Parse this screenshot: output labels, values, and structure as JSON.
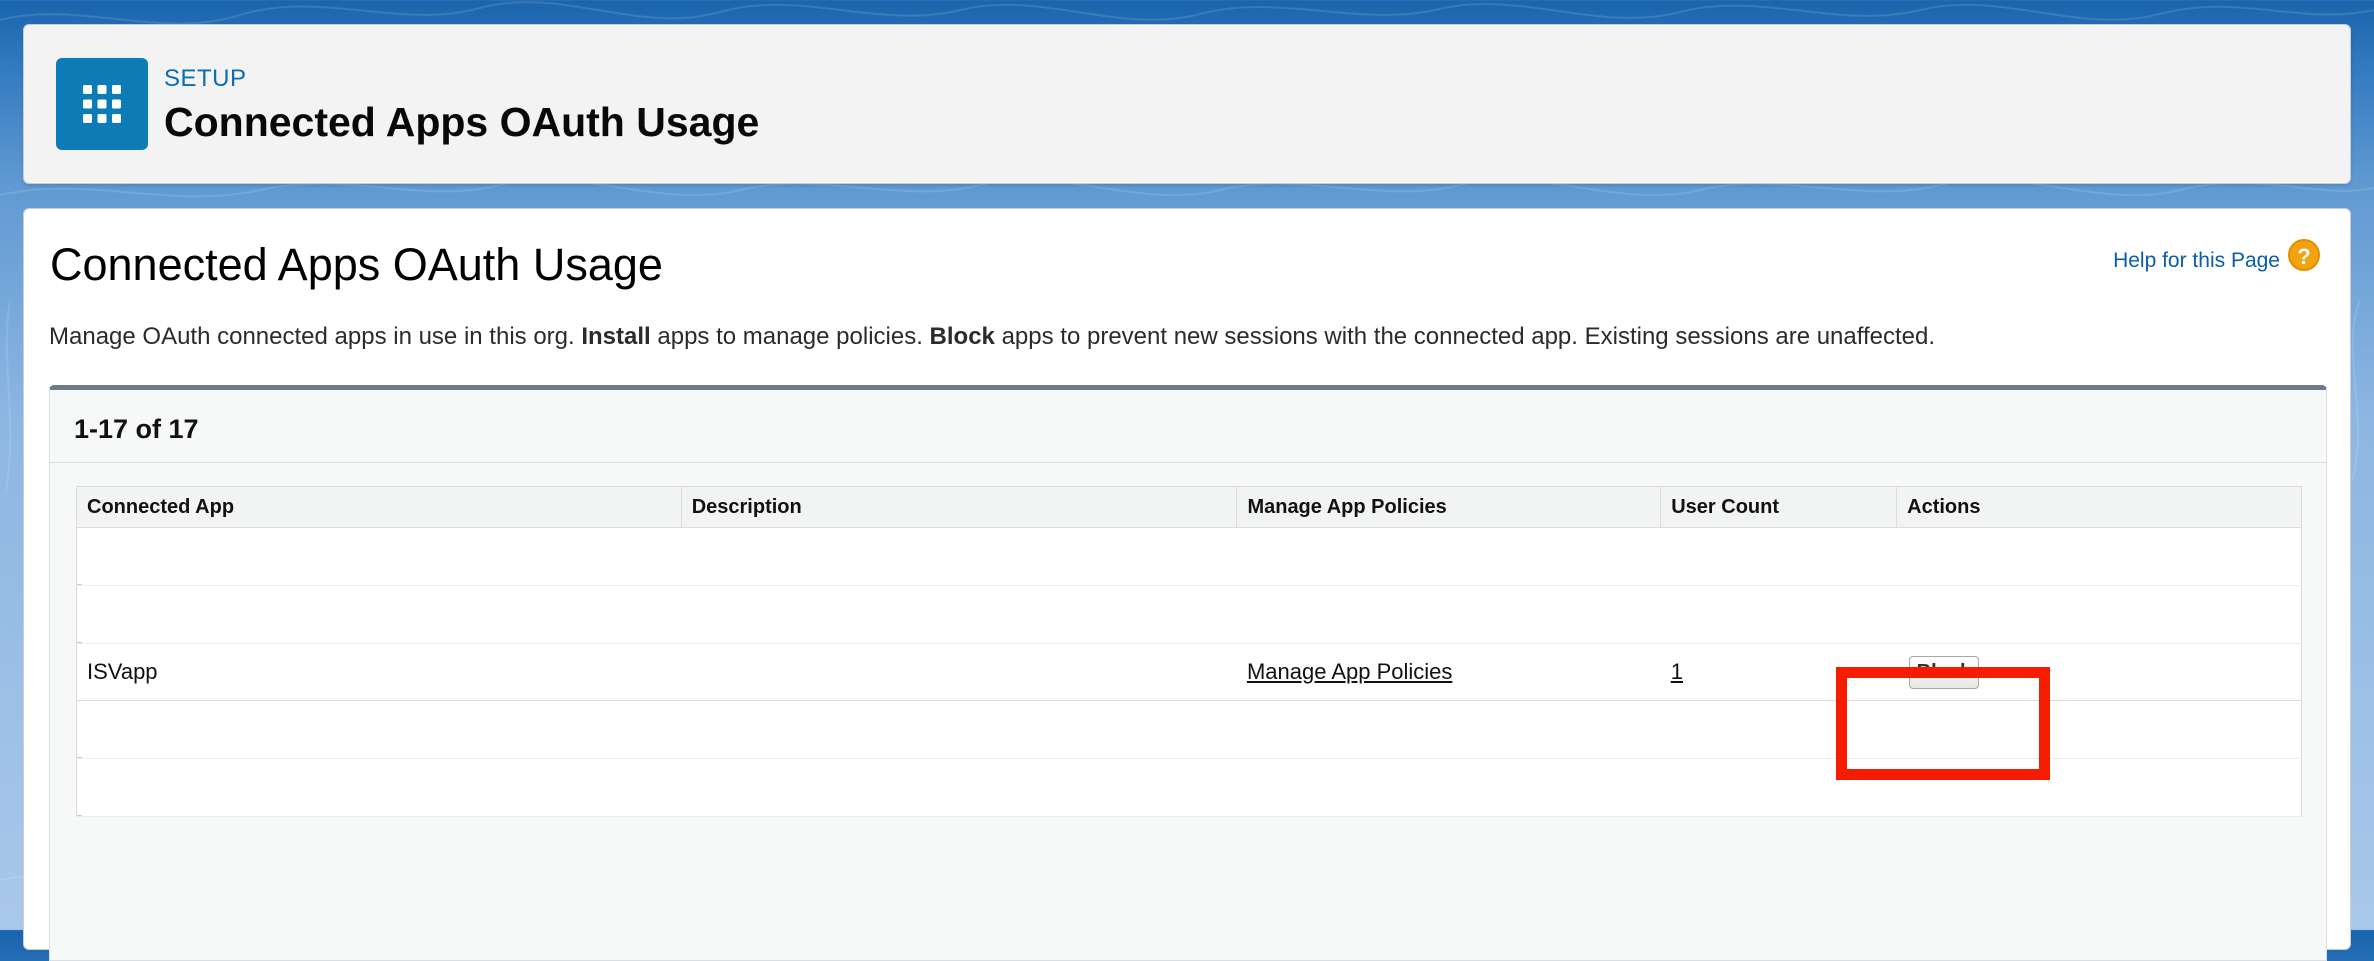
{
  "header": {
    "section_label": "SETUP",
    "title": "Connected Apps OAuth Usage",
    "app_icon": "app-grid-icon"
  },
  "main": {
    "heading": "Connected Apps OAuth Usage",
    "help_link": "Help for this Page",
    "help_icon": "question-mark-icon",
    "description": {
      "part1": "Manage OAuth connected apps in use in this org.",
      "bold1": "Install",
      "part2": "apps to manage policies.",
      "bold2": "Block",
      "part3": "apps to prevent new sessions with the connected app. Existing sessions are unaffected."
    },
    "pager": "1-17 of 17"
  },
  "table": {
    "columns": [
      "Connected App",
      "Description",
      "Manage App Policies",
      "User Count",
      "Actions"
    ],
    "rows": [
      {
        "connected_app": "ISVapp",
        "description": "",
        "manage_policies": "Manage App Policies",
        "user_count": "1",
        "action": "Block"
      }
    ]
  },
  "colors": {
    "accent": "#0d7bb5",
    "link": "#0b5cab",
    "highlight": "#f51c00"
  }
}
